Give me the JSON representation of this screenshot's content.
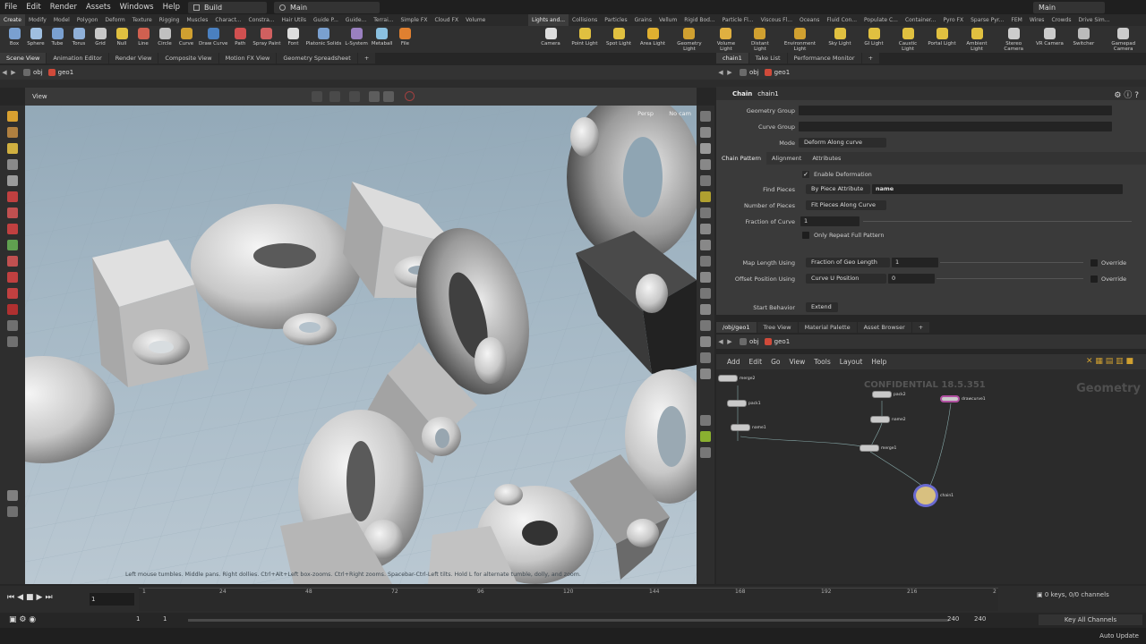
{
  "menubar": {
    "items": [
      "File",
      "Edit",
      "Render",
      "Assets",
      "Windows",
      "Help"
    ],
    "desktop": "Build",
    "context": "Main",
    "window_title": "Main"
  },
  "shelf_tabs_left": [
    "Create",
    "Modify",
    "Model",
    "Polygon",
    "Deform",
    "Texture",
    "Rigging",
    "Muscles",
    "Charact...",
    "Constra...",
    "Hair Utils",
    "Guide P...",
    "Guide...",
    "Terrai...",
    "Simple FX",
    "Cloud FX",
    "Volume"
  ],
  "shelf_tabs_right": [
    "Lights and...",
    "Collisions",
    "Particles",
    "Grains",
    "Vellum",
    "Rigid Bod...",
    "Particle Fl...",
    "Viscous Fl...",
    "Oceans",
    "Fluid Con...",
    "Populate C...",
    "Container...",
    "Pyro FX",
    "Sparse Pyr...",
    "FEM",
    "Wires",
    "Crowds",
    "Drive Sim..."
  ],
  "shelf_tools_left": [
    "Box",
    "Sphere",
    "Tube",
    "Torus",
    "Grid",
    "Null",
    "Line",
    "Circle",
    "Curve",
    "Draw Curve",
    "Path",
    "Spray Paint",
    "Font",
    "Platonic Solids",
    "L-System",
    "Metaball",
    "File"
  ],
  "shelf_tools_right": [
    "Camera",
    "Point Light",
    "Spot Light",
    "Area Light",
    "Geometry Light",
    "Volume Light",
    "Distant Light",
    "Environment Light",
    "Sky Light",
    "GI Light",
    "Caustic Light",
    "Portal Light",
    "Ambient Light",
    "Stereo Camera",
    "VR Camera",
    "Switcher",
    "Gamepad Camera"
  ],
  "left_pane": {
    "tabs": [
      "Scene View",
      "Animation Editor",
      "Render View",
      "Composite View",
      "Motion FX View",
      "Geometry Spreadsheet"
    ],
    "path": [
      "obj",
      "geo1"
    ],
    "view_label": "View",
    "persp": "Persp",
    "cam": "No cam",
    "hint": "Left mouse tumbles. Middle pans. Right dollies. Ctrl+Alt+Left box-zooms. Ctrl+Right zooms. Spacebar-Ctrl-Left tilts. Hold L for alternate tumble, dolly, and zoom."
  },
  "params_pane": {
    "tabs": [
      "chain1",
      "Take List",
      "Performance Monitor"
    ],
    "path": [
      "obj",
      "geo1"
    ],
    "node_type": "Chain",
    "node_name": "chain1",
    "geometry_group_label": "Geometry Group",
    "curve_group_label": "Curve Group",
    "mode_label": "Mode",
    "mode_value": "Deform Along curve",
    "subtabs": [
      "Chain Pattern",
      "Alignment",
      "Attributes"
    ],
    "enable_deformation": "Enable Deformation",
    "find_pieces_label": "Find Pieces",
    "find_pieces_value": "By Piece Attribute",
    "find_pieces_attr": "name",
    "number_pieces_label": "Number of Pieces",
    "number_pieces_value": "Fit Pieces Along Curve",
    "fraction_label": "Fraction of Curve",
    "fraction_value": "1",
    "only_repeat": "Only Repeat Full Pattern",
    "map_length_label": "Map Length Using",
    "map_length_value": "Fraction of Geo Length",
    "map_length_num": "1",
    "override1": "Override",
    "offset_label": "Offset Position Using",
    "offset_value": "Curve U Position",
    "offset_num": "0",
    "override2": "Override",
    "start_label": "Start Behavior",
    "start_value": "Extend"
  },
  "network_pane": {
    "tabs": [
      "/obj/geo1",
      "Tree View",
      "Material Palette",
      "Asset Browser"
    ],
    "path": [
      "obj",
      "geo1"
    ],
    "menu": [
      "Add",
      "Edit",
      "Go",
      "View",
      "Tools",
      "Layout",
      "Help"
    ],
    "watermark": "CONFIDENTIAL 18.5.351",
    "context_label": "Geometry",
    "nodes": [
      "merge2",
      "pack1",
      "name1",
      "pack2",
      "name2",
      "merge1",
      "drawcurve1",
      "chain1"
    ]
  },
  "timeline": {
    "frame": "1",
    "ticks": [
      "1",
      "24",
      "48",
      "72",
      "96",
      "120",
      "144",
      "168",
      "192",
      "216",
      "2"
    ],
    "range_start": "1",
    "range_start2": "1",
    "range_end": "240",
    "range_end2": "240",
    "keys": "0 keys, 0/0 channels",
    "key_all": "Key All Channels",
    "auto_update": "Auto Update"
  }
}
